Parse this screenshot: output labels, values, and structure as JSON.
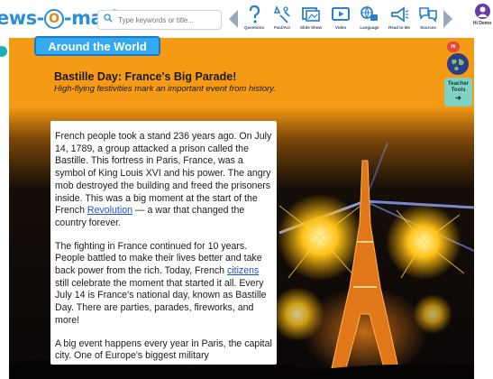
{
  "app": {
    "logo_text_left": "ews-",
    "logo_text_o": "O",
    "logo_text_right": "-matic"
  },
  "search": {
    "placeholder": "Type keywords or title..."
  },
  "toolbar": {
    "tools": [
      {
        "label": "Questions",
        "icon": "question-icon"
      },
      {
        "label": "Fact/Act",
        "icon": "fact-icon"
      },
      {
        "label": "Slide Show",
        "icon": "slideshow-icon"
      },
      {
        "label": "Video",
        "icon": "video-icon"
      },
      {
        "label": "Language",
        "icon": "language-icon"
      },
      {
        "label": "Read to Me",
        "icon": "megaphone-icon"
      },
      {
        "label": "Sources",
        "icon": "sources-icon"
      }
    ],
    "user_label": "Hi Demo"
  },
  "colors": {
    "accent": "#f59a14",
    "brand_blue": "#2a8fd6",
    "tab_blue": "#33aaf0",
    "link": "#1d4fd6"
  },
  "section": {
    "label": "Around the World"
  },
  "article": {
    "title": "Bastille Day: France's Big Parade!",
    "subtitle": "High-flying festivities mark an important event from history.",
    "p1_before_link": "French people took a stand 236 years ago. On July 14, 1789, a group attacked a prison called the Bastille. This fortress in Paris, France, was a symbol of King Louis XVI and his power. The angry mob destroyed the building and freed the prisoners inside. This was a big moment at the start of the French ",
    "p1_link": "Revolution",
    "p1_after_link": " — a war that changed the country forever.",
    "p2_before_link": "The fighting in France continued for 10 years. People battled to make their lives better and take back power from the rich. Today, French ",
    "p2_link": "citizens",
    "p2_after_link": " still celebrate the moment that started it all. Every July 14 is France's national day, known as Bastille Day. There are parties, parades, fireworks, and more!",
    "p3": "A big event happens every year in Paris, the capital city. One of Europe's biggest military"
  },
  "side": {
    "hi_badge": "Hi",
    "teacher_tools_line1": "Teacher",
    "teacher_tools_line2": "Tools",
    "teacher_tools_arrow": "➜"
  }
}
